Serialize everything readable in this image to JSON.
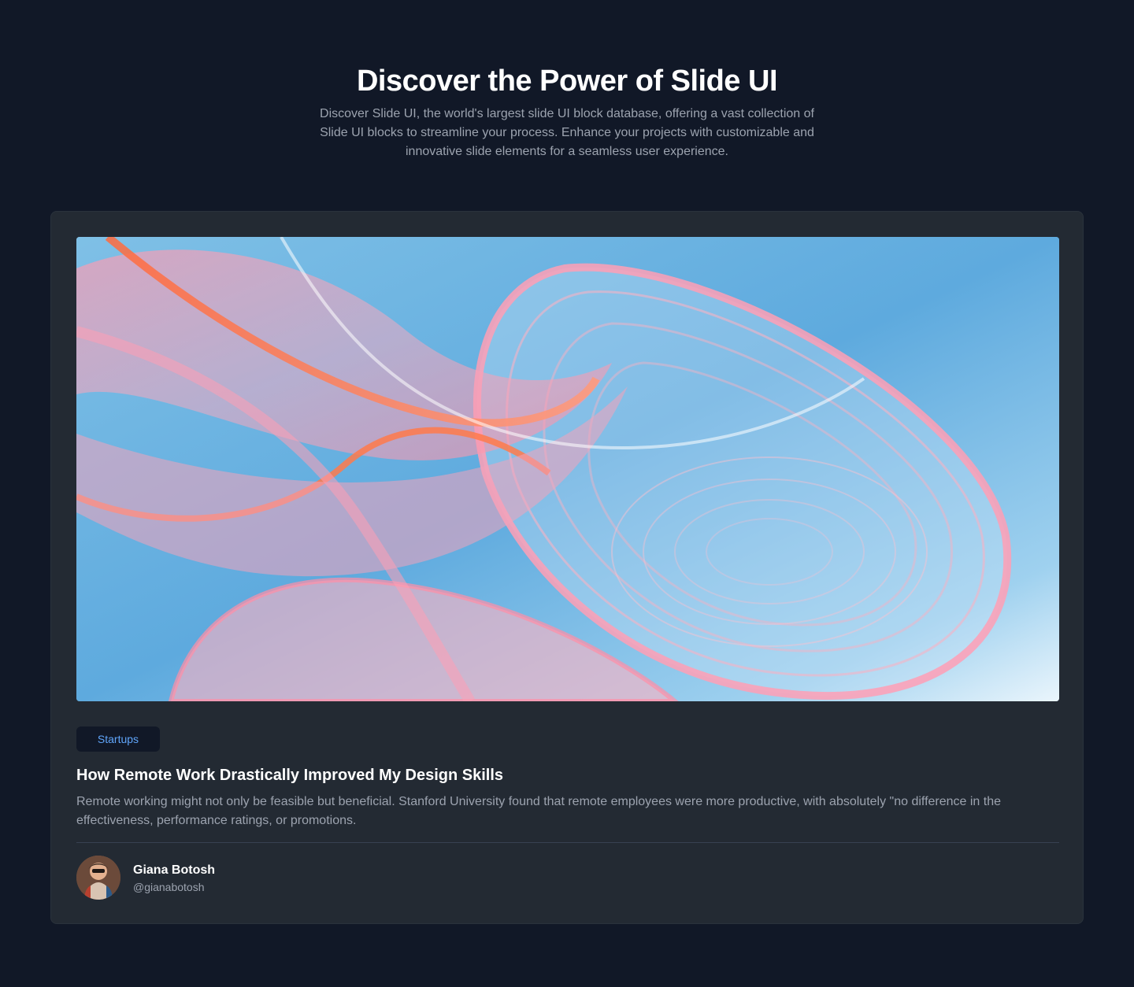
{
  "hero": {
    "title": "Discover the Power of Slide UI",
    "subtitle": "Discover Slide UI, the world's largest slide UI block database, offering a vast collection of Slide UI blocks to streamline your process. Enhance your projects with customizable and innovative slide elements for a seamless user experience."
  },
  "post": {
    "tag": "Startups",
    "title": "How Remote Work Drastically Improved My Design Skills",
    "excerpt": "Remote working might not only be feasible but beneficial. Stanford University found that remote employees were more productive, with absolutely \"no difference in the effectiveness, performance ratings, or promotions.",
    "author": {
      "name": "Giana Botosh",
      "handle": "@gianabotosh"
    }
  },
  "colors": {
    "background": "#111827",
    "card": "#232a33",
    "tag_text": "#60a5fa",
    "muted_text": "#9ca3af"
  }
}
